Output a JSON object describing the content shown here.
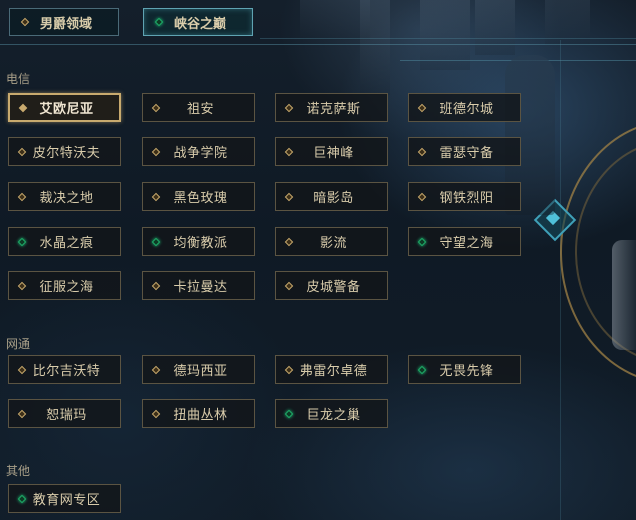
{
  "tabs": [
    {
      "label": "男爵领域",
      "active": false,
      "status": "orange"
    },
    {
      "label": "峡谷之巅",
      "active": true,
      "status": "green"
    }
  ],
  "sections": [
    {
      "label": "电信",
      "servers": [
        {
          "label": "艾欧尼亚",
          "status": "orange",
          "selected": true
        },
        {
          "label": "祖安",
          "status": "orange"
        },
        {
          "label": "诺克萨斯",
          "status": "orange"
        },
        {
          "label": "班德尔城",
          "status": "orange"
        },
        {
          "label": "皮尔特沃夫",
          "status": "orange"
        },
        {
          "label": "战争学院",
          "status": "orange"
        },
        {
          "label": "巨神峰",
          "status": "orange"
        },
        {
          "label": "雷瑟守备",
          "status": "orange"
        },
        {
          "label": "裁决之地",
          "status": "orange"
        },
        {
          "label": "黑色玫瑰",
          "status": "orange"
        },
        {
          "label": "暗影岛",
          "status": "orange"
        },
        {
          "label": "钢铁烈阳",
          "status": "orange"
        },
        {
          "label": "水晶之痕",
          "status": "green"
        },
        {
          "label": "均衡教派",
          "status": "green"
        },
        {
          "label": "影流",
          "status": "orange"
        },
        {
          "label": "守望之海",
          "status": "green"
        },
        {
          "label": "征服之海",
          "status": "orange"
        },
        {
          "label": "卡拉曼达",
          "status": "orange"
        },
        {
          "label": "皮城警备",
          "status": "orange"
        }
      ]
    },
    {
      "label": "网通",
      "servers": [
        {
          "label": "比尔吉沃特",
          "status": "orange"
        },
        {
          "label": "德玛西亚",
          "status": "orange"
        },
        {
          "label": "弗雷尔卓德",
          "status": "orange"
        },
        {
          "label": "无畏先锋",
          "status": "green"
        },
        {
          "label": "恕瑞玛",
          "status": "orange"
        },
        {
          "label": "扭曲丛林",
          "status": "orange"
        },
        {
          "label": "巨龙之巢",
          "status": "green"
        }
      ]
    },
    {
      "label": "其他",
      "servers": [
        {
          "label": "教育网专区",
          "status": "green"
        }
      ]
    }
  ],
  "colors": {
    "accent_gold": "#c8aa6e",
    "status_green": "#1fb06a",
    "status_orange": "#c8aa6e",
    "text": "#d9ccab"
  }
}
